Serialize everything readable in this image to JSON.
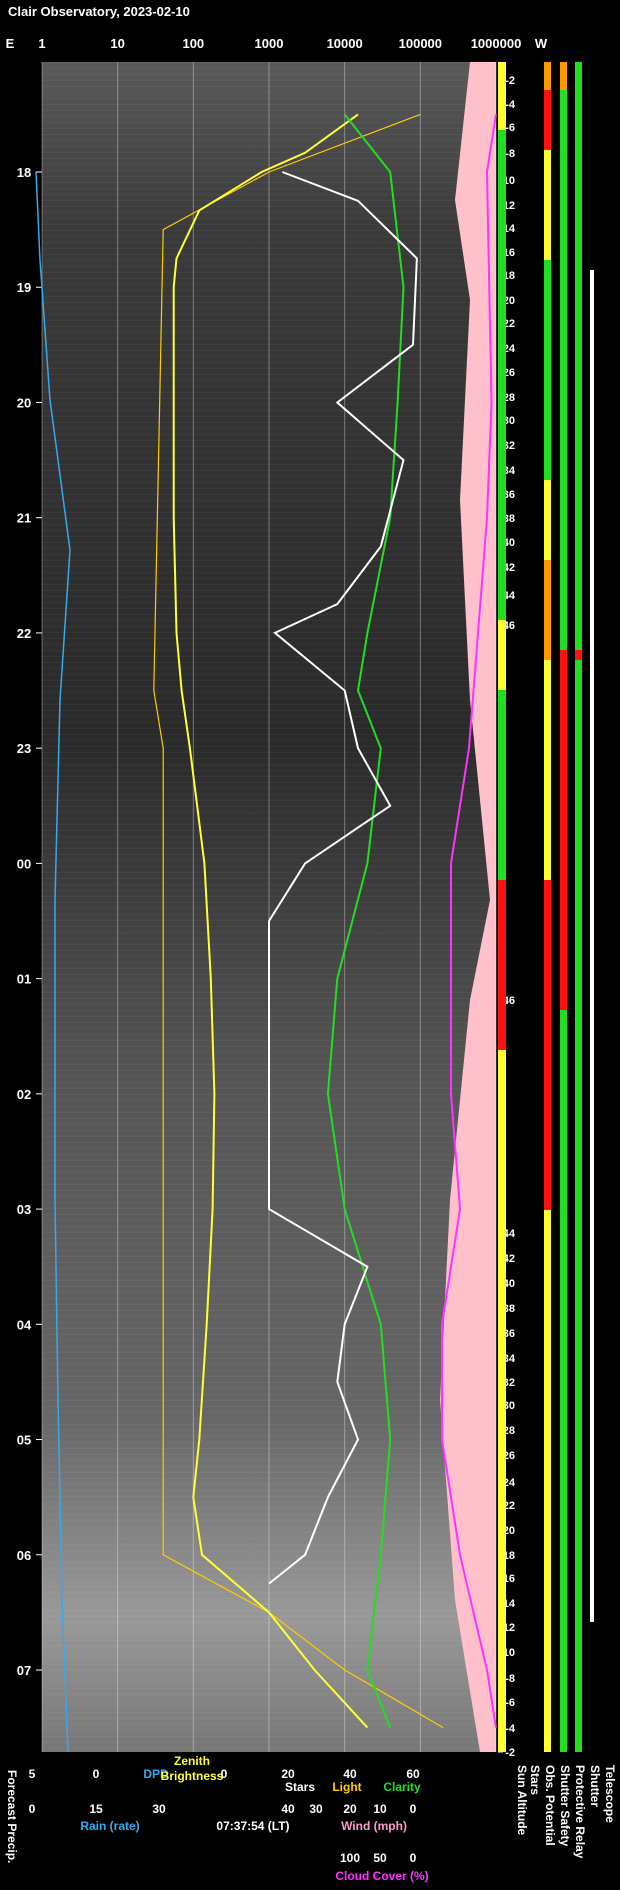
{
  "title": "Clair Observatory, 2023-02-10",
  "chart_data": {
    "type": "line",
    "top_axis": {
      "left_label": "E",
      "right_label": "W",
      "scale": "log",
      "ticks": [
        "1",
        "10",
        "100",
        "1000",
        "10000",
        "100000",
        "1000000"
      ]
    },
    "time_ticks": [
      "18",
      "19",
      "20",
      "21",
      "22",
      "23",
      "00",
      "01",
      "02",
      "03",
      "04",
      "05",
      "06",
      "07"
    ],
    "sun_altitude_ticks": [
      -2,
      -4,
      -6,
      -8,
      -10,
      -12,
      -14,
      -16,
      -18,
      -20,
      -22,
      -24,
      -26,
      -28,
      -30,
      -32,
      -34,
      -36,
      -38,
      -40,
      -42,
      -44,
      -46,
      -46,
      -44,
      -42,
      -40,
      -38,
      -36,
      -34,
      -32,
      -30,
      -28,
      -26,
      -24,
      -22,
      -20,
      -18,
      -16,
      -14,
      -12,
      -10,
      -8,
      -6,
      -4,
      -2
    ],
    "series": [
      {
        "name": "Zenith Brightness",
        "color": "#ffff33"
      },
      {
        "name": "Stars",
        "color": "#ffffff"
      },
      {
        "name": "Light",
        "color": "#ffcc00"
      },
      {
        "name": "Clarity",
        "color": "#22dd22"
      },
      {
        "name": "Cloud Cover (%)",
        "color": "#ff33ff"
      },
      {
        "name": "DPD",
        "color": "#33aaee"
      }
    ],
    "zenith": [
      {
        "t": "17:30",
        "v": 15000
      },
      {
        "t": "17:50",
        "v": 3000
      },
      {
        "t": "18:00",
        "v": 800
      },
      {
        "t": "18:20",
        "v": 120
      },
      {
        "t": "18:45",
        "v": 60
      },
      {
        "t": "19:00",
        "v": 55
      },
      {
        "t": "20:00",
        "v": 55
      },
      {
        "t": "21:00",
        "v": 55
      },
      {
        "t": "22:00",
        "v": 60
      },
      {
        "t": "22:30",
        "v": 70
      },
      {
        "t": "23:00",
        "v": 90
      },
      {
        "t": "00:00",
        "v": 140
      },
      {
        "t": "01:00",
        "v": 170
      },
      {
        "t": "02:00",
        "v": 190
      },
      {
        "t": "03:00",
        "v": 180
      },
      {
        "t": "04:00",
        "v": 150
      },
      {
        "t": "05:00",
        "v": 120
      },
      {
        "t": "05:30",
        "v": 100
      },
      {
        "t": "06:00",
        "v": 130
      },
      {
        "t": "06:30",
        "v": 1000
      },
      {
        "t": "07:00",
        "v": 4000
      },
      {
        "t": "07:30",
        "v": 20000
      }
    ],
    "stars": [
      {
        "t": "18:00",
        "v": 1500
      },
      {
        "t": "18:15",
        "v": 15000
      },
      {
        "t": "18:45",
        "v": 90000
      },
      {
        "t": "19:30",
        "v": 80000
      },
      {
        "t": "20:00",
        "v": 8000
      },
      {
        "t": "20:30",
        "v": 60000
      },
      {
        "t": "21:15",
        "v": 30000
      },
      {
        "t": "21:45",
        "v": 8000
      },
      {
        "t": "22:00",
        "v": 1200
      },
      {
        "t": "22:30",
        "v": 10000
      },
      {
        "t": "23:00",
        "v": 15000
      },
      {
        "t": "23:30",
        "v": 40000
      },
      {
        "t": "00:00",
        "v": 3000
      },
      {
        "t": "00:30",
        "v": 1000
      },
      {
        "t": "01:30",
        "v": 1000
      },
      {
        "t": "03:00",
        "v": 1000
      },
      {
        "t": "03:30",
        "v": 20000
      },
      {
        "t": "04:00",
        "v": 10000
      },
      {
        "t": "04:30",
        "v": 8000
      },
      {
        "t": "05:00",
        "v": 15000
      },
      {
        "t": "05:30",
        "v": 6000
      },
      {
        "t": "06:00",
        "v": 3000
      },
      {
        "t": "06:15",
        "v": 1000
      }
    ],
    "light": [
      {
        "t": "17:30",
        "v": 100000
      },
      {
        "t": "18:00",
        "v": 1000
      },
      {
        "t": "18:30",
        "v": 40
      },
      {
        "t": "22:30",
        "v": 30
      },
      {
        "t": "23:00",
        "v": 40
      },
      {
        "t": "06:00",
        "v": 40
      },
      {
        "t": "06:30",
        "v": 1000
      },
      {
        "t": "07:00",
        "v": 10000
      },
      {
        "t": "07:30",
        "v": 200000
      }
    ],
    "clarity": [
      {
        "t": "17:30",
        "v": 10000
      },
      {
        "t": "18:00",
        "v": 40000
      },
      {
        "t": "19:00",
        "v": 60000
      },
      {
        "t": "20:00",
        "v": 50000
      },
      {
        "t": "21:00",
        "v": 40000
      },
      {
        "t": "22:00",
        "v": 20000
      },
      {
        "t": "22:30",
        "v": 15000
      },
      {
        "t": "23:00",
        "v": 30000
      },
      {
        "t": "00:00",
        "v": 20000
      },
      {
        "t": "01:00",
        "v": 8000
      },
      {
        "t": "02:00",
        "v": 6000
      },
      {
        "t": "03:00",
        "v": 10000
      },
      {
        "t": "04:00",
        "v": 30000
      },
      {
        "t": "05:00",
        "v": 40000
      },
      {
        "t": "06:00",
        "v": 30000
      },
      {
        "t": "07:00",
        "v": 20000
      },
      {
        "t": "07:30",
        "v": 40000
      }
    ],
    "cloud_cover": [
      {
        "t": "17:30",
        "v": 0
      },
      {
        "t": "18:00",
        "v": 10
      },
      {
        "t": "20:00",
        "v": 5
      },
      {
        "t": "21:00",
        "v": 10
      },
      {
        "t": "22:00",
        "v": 20
      },
      {
        "t": "23:00",
        "v": 30
      },
      {
        "t": "00:00",
        "v": 50
      },
      {
        "t": "02:00",
        "v": 50
      },
      {
        "t": "03:00",
        "v": 40
      },
      {
        "t": "04:00",
        "v": 60
      },
      {
        "t": "05:00",
        "v": 60
      },
      {
        "t": "06:00",
        "v": 40
      },
      {
        "t": "07:00",
        "v": 10
      },
      {
        "t": "07:30",
        "v": 0
      }
    ],
    "status_columns": [
      "Sun Altitude",
      "Stars",
      "Obs. Potential",
      "Shutter Safety",
      "Protective Relay",
      "Shutter",
      "Telescope"
    ],
    "bottom_axes": [
      {
        "label": "DPD",
        "color": "#33aaee",
        "ticks": [
          "5",
          "0"
        ]
      },
      {
        "label": "Zenith Brightness",
        "color": "#ffff33",
        "ticks": [
          "30",
          "0"
        ]
      },
      {
        "label": "Rain (rate)",
        "color": "#33aaee",
        "ticks": [
          "0",
          "15",
          "30"
        ]
      },
      {
        "label": "Stars",
        "color": "#ffffff",
        "ticks": [
          "0",
          "20",
          "40",
          "60"
        ]
      },
      {
        "label": "Light",
        "color": "#ffcc00"
      },
      {
        "label": "Clarity",
        "color": "#22dd22"
      },
      {
        "label": "Wind (mph)",
        "color": "#ff99cc",
        "ticks": [
          "40",
          "30",
          "20",
          "10",
          "0"
        ]
      },
      {
        "label": "Cloud Cover (%)",
        "color": "#ff33ff",
        "ticks": [
          "100",
          "50",
          "0"
        ]
      }
    ],
    "forecast_label": "Forecast Precip.",
    "timestamp": "07:37:54 (LT)"
  }
}
